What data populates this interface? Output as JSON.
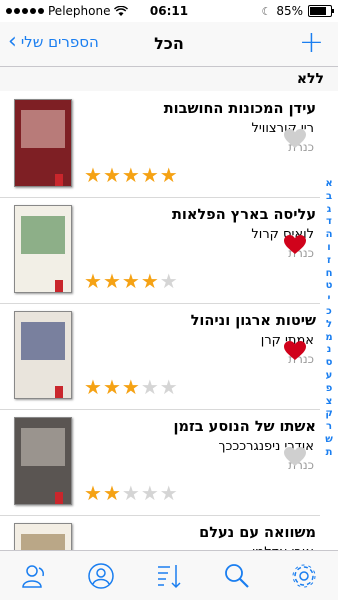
{
  "status_bar": {
    "carrier": "Pelephone",
    "time": "06:11",
    "battery": "85%",
    "battery_level": 0.85
  },
  "nav": {
    "back_label": "הספרים שלי",
    "title": "הכל",
    "add_icon": "plus-icon"
  },
  "section": {
    "header": "ללא"
  },
  "books": [
    {
      "title": "עידן המכונות החושבות",
      "author": "ריי קורצוויל",
      "publisher": "כנרת",
      "rating": 5,
      "favorite": false,
      "cover": {
        "bg": "#7e1f24",
        "accent": "#e8c7c0",
        "text": "עידן המכונות החושבות"
      }
    },
    {
      "title": "עליסה בארץ הפלאות",
      "author": "לואיס קרול",
      "publisher": "כנרת",
      "rating": 4,
      "favorite": true,
      "cover": {
        "bg": "#f2efe6",
        "accent": "#3a7a3a",
        "text": "עליסה בארץ הפלאות"
      }
    },
    {
      "title": "שיטות ארגון וניהול",
      "author": "אמתי קרן",
      "publisher": "כנרת",
      "rating": 3,
      "favorite": true,
      "cover": {
        "bg": "#e9e4dc",
        "accent": "#1d2d6b",
        "text": "שיטות ארגון וניהול"
      }
    },
    {
      "title": "אשתו של הנוסע בזמן",
      "author": "אודרי ניפנגרכככך",
      "publisher": "כנרת",
      "rating": 2,
      "favorite": false,
      "cover": {
        "bg": "#5a5552",
        "accent": "#cfc8c0",
        "text": "אשתו של הנוסע בזמן"
      }
    },
    {
      "title": "משוואה עם נעלם",
      "author": "אורי אדלמן",
      "publisher": "",
      "rating": 0,
      "favorite": false,
      "cover": {
        "bg": "#f3eee4",
        "accent": "#8a6d3b",
        "text": "משוואה עם נעלם"
      }
    }
  ],
  "index_letters": [
    "א",
    "ב",
    "ג",
    "ד",
    "ה",
    "ו",
    "ז",
    "ח",
    "ט",
    "י",
    "כ",
    "ל",
    "מ",
    "נ",
    "ס",
    "ע",
    "פ",
    "צ",
    "ק",
    "ר",
    "ש",
    "ת"
  ],
  "tab_bar": {
    "tabs": [
      "contacts-icon",
      "profile-icon",
      "sort-icon",
      "search-icon",
      "gear-icon"
    ]
  },
  "colors": {
    "accent": "#1a7ef0",
    "star_on": "#f5a214",
    "star_off": "#d5d5d5",
    "heart_on": "#d0021b",
    "heart_off": "#cfcfcf"
  }
}
